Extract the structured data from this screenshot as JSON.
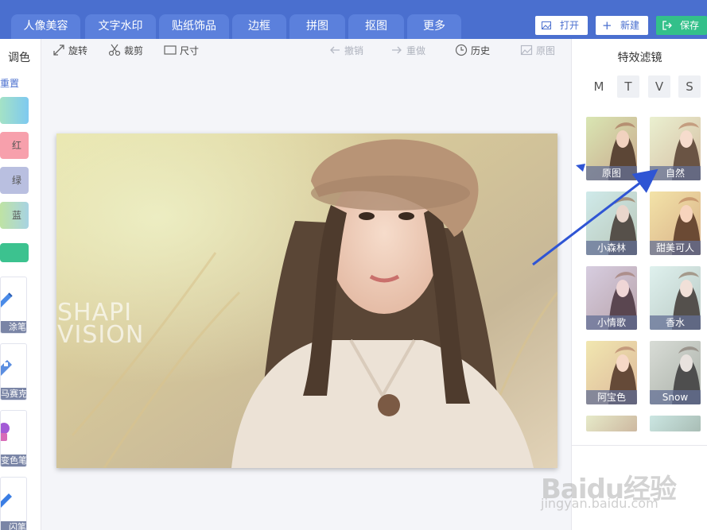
{
  "tabs": [
    {
      "label": "人像美容"
    },
    {
      "label": "文字水印"
    },
    {
      "label": "贴纸饰品"
    },
    {
      "label": "边框"
    },
    {
      "label": "拼图"
    },
    {
      "label": "抠图"
    },
    {
      "label": "更多"
    }
  ],
  "actions": {
    "open": "打开",
    "new": "新建",
    "save": "保存"
  },
  "left": {
    "title": "调色",
    "reset": "重置",
    "swatches": [
      "红",
      "绿",
      "蓝"
    ],
    "tools": [
      "涂笔",
      "马赛克",
      "变色笔",
      "闪笔"
    ]
  },
  "toolbar": {
    "rotate": "旋转",
    "crop": "裁剪",
    "size": "尺寸",
    "undo": "撤销",
    "redo": "重做",
    "history": "历史",
    "original": "原图"
  },
  "canvas": {
    "watermark_line1": "SHAPI",
    "watermark_line2": "VISION"
  },
  "filters": {
    "title": "特效滤镜",
    "tabs": [
      "M",
      "T",
      "V",
      "S"
    ],
    "items": [
      {
        "label": "原图"
      },
      {
        "label": "自然"
      },
      {
        "label": "小森林"
      },
      {
        "label": "甜美可人"
      },
      {
        "label": "小情歌"
      },
      {
        "label": "香水"
      },
      {
        "label": "阿宝色"
      },
      {
        "label": "Snow"
      }
    ]
  },
  "watermark": {
    "brand": "Baidu经验",
    "url": "jingyan.baidu.com"
  },
  "colors": {
    "accent": "#4a6fcf",
    "save_green": "#33c08a",
    "annotation_arrow": "#2f55d4"
  }
}
